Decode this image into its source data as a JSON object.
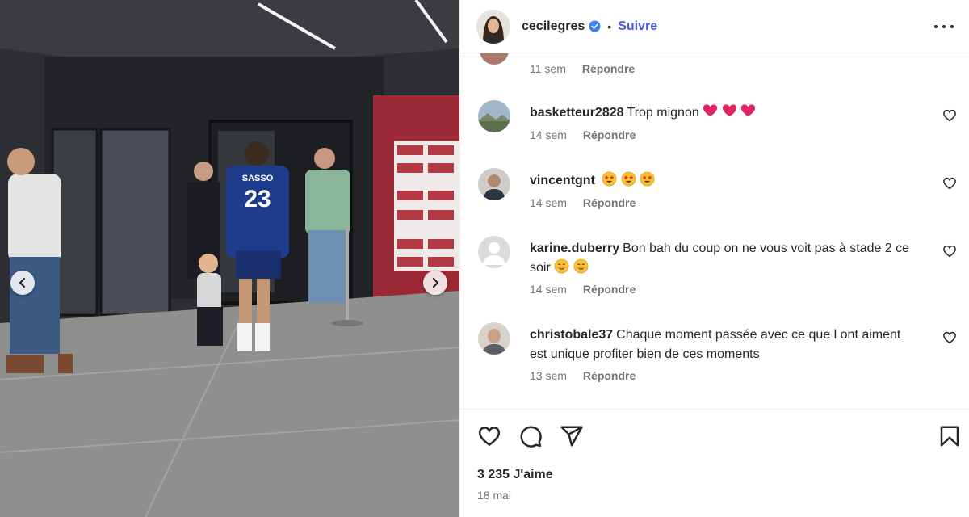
{
  "post": {
    "author": {
      "username": "cecilegres",
      "verified": true,
      "separator": "•",
      "follow_label": "Suivre"
    },
    "top_meta": {
      "time": "11 sem",
      "reply_label": "Répondre"
    },
    "comments": [
      {
        "user": "basketteur2828",
        "text": "Trop mignon",
        "emojis": [
          "red-heart",
          "red-heart",
          "red-heart"
        ],
        "time": "14 sem",
        "reply_label": "Répondre"
      },
      {
        "user": "vincentgnt",
        "text": "",
        "emojis": [
          "star-struck",
          "star-struck",
          "star-struck"
        ],
        "time": "14 sem",
        "reply_label": "Répondre"
      },
      {
        "user": "karine.duberry",
        "text": "Bon bah du coup on ne vous voit pas à stade 2 ce soir",
        "emojis": [
          "smiling-face",
          "smiling-face"
        ],
        "time": "14 sem",
        "reply_label": "Répondre"
      },
      {
        "user": "christobale37",
        "text": "Chaque moment passée avec ce que l ont aiment est unique profiter bien de ces moments",
        "emojis": [],
        "time": "13 sem",
        "reply_label": "Répondre"
      }
    ],
    "likes": "3 235 J'aime",
    "date": "18 mai",
    "photo": {
      "jersey_name": "SASSO",
      "jersey_number": "23"
    }
  },
  "colors": {
    "follow": "#4a5ddf",
    "meta": "#737373",
    "text": "#262626",
    "heart_red": "#e0245e"
  }
}
